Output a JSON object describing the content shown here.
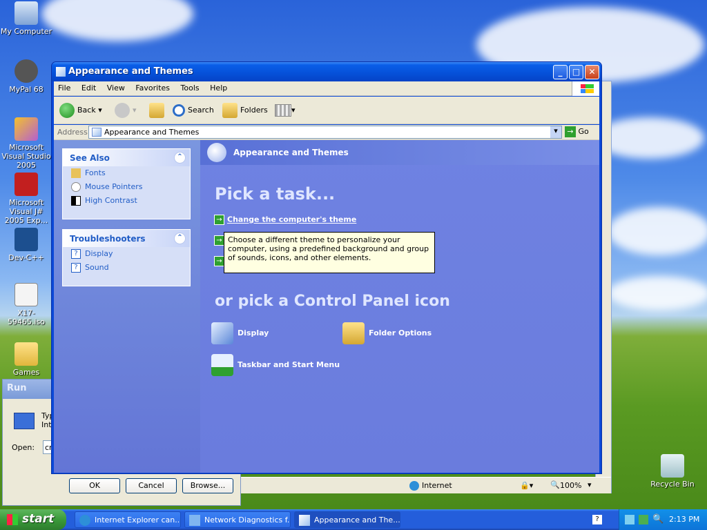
{
  "desktop": {
    "icons": [
      {
        "label": "My Computer"
      },
      {
        "label": "MyPal 68"
      },
      {
        "label": "Microsoft Visual Studio 2005"
      },
      {
        "label": "Microsoft Visual J# 2005 Exp..."
      },
      {
        "label": "Dev-C++"
      },
      {
        "label": "X17-59465.iso"
      },
      {
        "label": "Games"
      },
      {
        "label": "Recycle Bin"
      }
    ]
  },
  "run_dialog": {
    "title": "Run",
    "desc": "Typ\nInt",
    "open_label": "Open:",
    "open_value": "cr",
    "ok": "OK",
    "cancel": "Cancel",
    "browse": "Browse..."
  },
  "window": {
    "title": "Appearance and Themes",
    "menu": [
      "File",
      "Edit",
      "View",
      "Favorites",
      "Tools",
      "Help"
    ],
    "toolbar": {
      "back": "Back",
      "search": "Search",
      "folders": "Folders"
    },
    "address_label": "Address",
    "address_value": "Appearance and Themes",
    "go": "Go"
  },
  "left_pane": {
    "see_also": {
      "title": "See Also",
      "items": [
        "Fonts",
        "Mouse Pointers",
        "High Contrast"
      ]
    },
    "troubleshooters": {
      "title": "Troubleshooters",
      "items": [
        "Display",
        "Sound"
      ]
    }
  },
  "main_pane": {
    "header": "Appearance and Themes",
    "pick_task": "Pick a task...",
    "tasks": [
      "Change the computer's theme"
    ],
    "tooltip": "Choose a different theme to personalize your computer, using a predefined background and group of sounds, icons, and other elements.",
    "or_pick": "or pick a Control Panel icon",
    "icons": [
      "Display",
      "Folder Options",
      "Taskbar and Start Menu"
    ]
  },
  "statusbar": {
    "zone": "Internet",
    "zoom": "100%"
  },
  "taskbar": {
    "start": "start",
    "tasks": [
      "Internet Explorer can...",
      "Network Diagnostics f...",
      "Appearance and The..."
    ],
    "clock": "2:13 PM"
  }
}
